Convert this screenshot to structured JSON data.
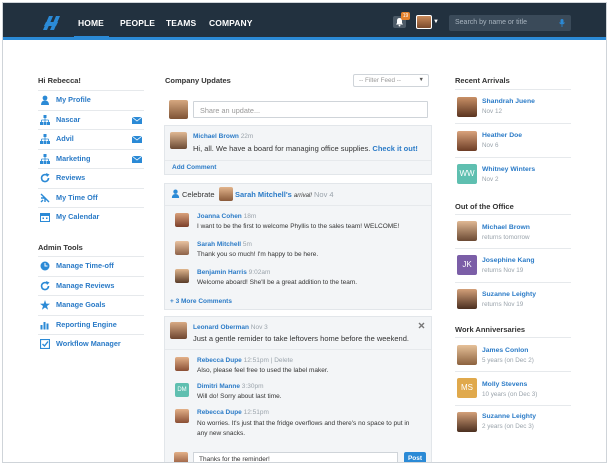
{
  "nav": {
    "items": [
      "HOME",
      "PEOPLE",
      "TEAMS",
      "COMPANY"
    ],
    "notification_count": "19",
    "search_placeholder": "Search by name or title"
  },
  "sidebar": {
    "greeting": "Hi Rebecca!",
    "items": [
      {
        "label": "My Profile",
        "icon": "person-icon"
      },
      {
        "label": "Nascar",
        "icon": "org-chart-icon",
        "mail": true
      },
      {
        "label": "Advil",
        "icon": "org-chart-icon",
        "mail": true
      },
      {
        "label": "Marketing",
        "icon": "org-chart-icon",
        "mail": true
      },
      {
        "label": "Reviews",
        "icon": "refresh-icon"
      },
      {
        "label": "My Time Off",
        "icon": "airplane-icon"
      },
      {
        "label": "My Calendar",
        "icon": "calendar-icon"
      }
    ],
    "admin_title": "Admin Tools",
    "admin_items": [
      {
        "label": "Manage Time-off",
        "icon": "clock-icon"
      },
      {
        "label": "Manage Reviews",
        "icon": "refresh-icon"
      },
      {
        "label": "Manage Goals",
        "icon": "star-icon"
      },
      {
        "label": "Reporting Engine",
        "icon": "bar-chart-icon"
      },
      {
        "label": "Workflow Manager",
        "icon": "checkbox-icon"
      }
    ]
  },
  "feed": {
    "title": "Company Updates",
    "filter_label": "-- Filter Feed --",
    "share_placeholder": "Share an update...",
    "post1": {
      "author": "Michael Brown",
      "time": "22m",
      "text": "Hi, all. We have a board for managing office supplies.",
      "link": "Check it out!",
      "add_comment": "Add Comment"
    },
    "post2": {
      "prefix": "Celebrate",
      "name": "Sarah Mitchell's",
      "event": "arrival!",
      "time": "Nov 4",
      "comments": [
        {
          "author": "Joanna Cohen",
          "time": "18m",
          "text": "I want to be the first to welcome Phyllis to the sales team! WELCOME!"
        },
        {
          "author": "Sarah Mitchell",
          "time": "5m",
          "text": "Thank you so much! I'm happy to be here."
        },
        {
          "author": "Benjamin Harris",
          "time": "9:02am",
          "text": "Welcome aboard! She'll be a great addition to the team."
        }
      ],
      "more": "+ 3 More Comments"
    },
    "post3": {
      "author": "Leonard Oberman",
      "time": "Nov 3",
      "text": "Just a gentle remider to take leftovers home before the weekend.",
      "comments": [
        {
          "author": "Rebecca Dupe",
          "time": "12:51pm",
          "delete": "Delete",
          "text": "Also, please feel free to used the label maker."
        },
        {
          "author": "Dimitri Manne",
          "time": "3:30pm",
          "text": "Will do! Sorry about last time.",
          "initials": "DM"
        },
        {
          "author": "Rebecca Dupe",
          "time": "12:51pm",
          "text": "No worries. It's just that the fridge overflows and there's no space to put in any new snacks."
        }
      ],
      "reply_value": "Thanks for the reminder!",
      "post_label": "Post"
    }
  },
  "right": {
    "arrivals_title": "Recent Arrivals",
    "arrivals": [
      {
        "name": "Shandrah Juene",
        "sub": "Nov 12"
      },
      {
        "name": "Heather Doe",
        "sub": "Nov 6"
      },
      {
        "name": "Whitney Winters",
        "sub": "Nov 2",
        "initials": "WW"
      }
    ],
    "ooo_title": "Out of the Office",
    "ooo": [
      {
        "name": "Michael Brown",
        "sub": "returns tomorrow"
      },
      {
        "name": "Josephine Kang",
        "sub": "returns Nov 19",
        "initials": "JK"
      },
      {
        "name": "Suzanne Leighty",
        "sub": "returns Nov 19"
      }
    ],
    "anniv_title": "Work Anniversaries",
    "anniv": [
      {
        "name": "James Conlon",
        "sub": "5 years (on Dec 2)"
      },
      {
        "name": "Molly Stevens",
        "sub": "10 years (on Dec 3)",
        "initials": "MS"
      },
      {
        "name": "Suzanne Leighty",
        "sub": "2 years (on Dec 3)"
      }
    ]
  },
  "colors": {
    "accent": "#2b8ad6",
    "topbar": "#22313f",
    "link": "#2b7bc7",
    "badge": "#e4822d"
  }
}
